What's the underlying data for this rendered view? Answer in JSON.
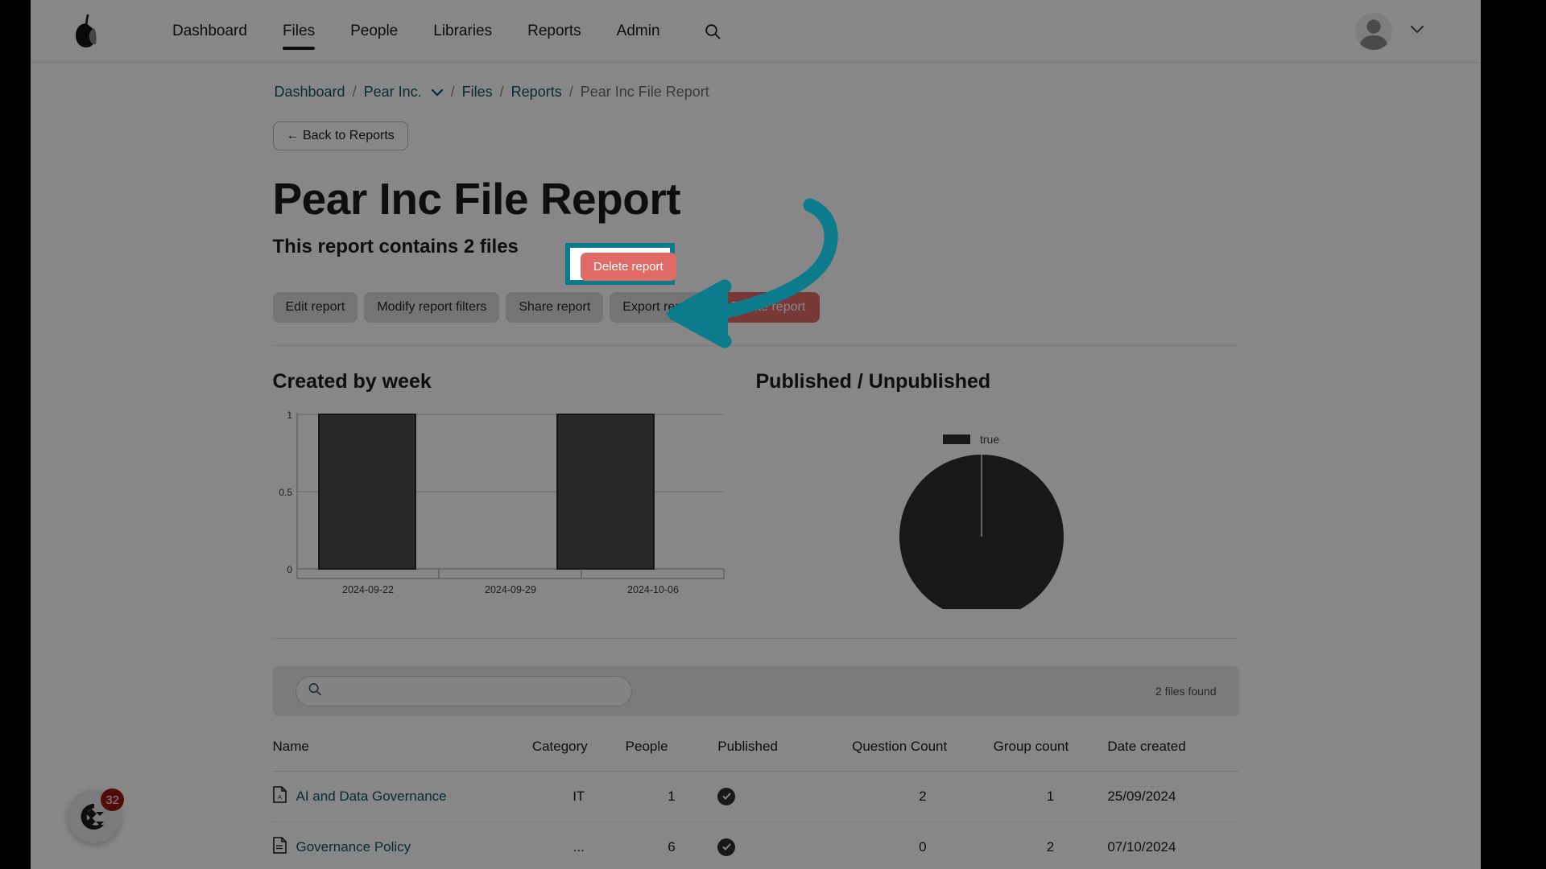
{
  "navbar": {
    "logo_name": "pear-logo",
    "links": [
      {
        "label": "Dashboard",
        "active": false
      },
      {
        "label": "Files",
        "active": true
      },
      {
        "label": "People",
        "active": false
      },
      {
        "label": "Libraries",
        "active": false
      },
      {
        "label": "Reports",
        "active": false
      },
      {
        "label": "Admin",
        "active": false
      }
    ],
    "search_icon": "search-icon",
    "avatar_icon": "user-avatar-icon",
    "chevron": "⌄"
  },
  "breadcrumb": {
    "items": [
      {
        "label": "Dashboard",
        "type": "link"
      },
      {
        "label": "/",
        "type": "sep"
      },
      {
        "label": "Pear Inc.",
        "type": "link-dropdown"
      },
      {
        "label": "/",
        "type": "sep"
      },
      {
        "label": "Files",
        "type": "link"
      },
      {
        "label": "/",
        "type": "sep"
      },
      {
        "label": "Reports",
        "type": "link"
      },
      {
        "label": "/",
        "type": "sep"
      },
      {
        "label": "Pear Inc File Report",
        "type": "current"
      }
    ]
  },
  "back_button": {
    "label": "← Back to Reports"
  },
  "header": {
    "title": "Pear Inc File Report",
    "subtitle": "This report contains 2 files"
  },
  "actions": {
    "edit": "Edit report",
    "modify": "Modify report filters",
    "share": "Share report",
    "export": "Export report",
    "delete": "Delete report"
  },
  "annotation": {
    "highlight_color": "#0c7b8c",
    "highlight_target": "Delete report",
    "arrow_color": "#0c7b8c"
  },
  "charts": {
    "bar": {
      "title": "Created by week"
    },
    "pie": {
      "title": "Published / Unpublished"
    }
  },
  "chart_data": [
    {
      "type": "bar",
      "title": "Created by week",
      "categories": [
        "2024-09-22",
        "2024-09-29",
        "2024-10-06"
      ],
      "values": [
        1,
        0,
        1
      ],
      "xlabel": "",
      "ylabel": "",
      "ylim": [
        0,
        1
      ],
      "yticks": [
        "0",
        "0.5",
        "1"
      ],
      "grid": true,
      "legend": "none",
      "bar_color": "#4a4a4a"
    },
    {
      "type": "pie",
      "title": "Published / Unpublished",
      "categories": [
        "true"
      ],
      "values": [
        2
      ],
      "percentages": [
        100
      ],
      "legend": [
        "true"
      ],
      "legend_position": "top-right",
      "slice_color": "#2e2e2e"
    }
  ],
  "table": {
    "search_placeholder": "",
    "search_value": "",
    "search_icon": "search-icon",
    "files_found": "2 files found",
    "columns": [
      "Name",
      "Category",
      "People",
      "Published",
      "Question Count",
      "Group count",
      "Date created"
    ],
    "rows": [
      {
        "icon": "pdf-file-icon",
        "name": "AI and Data Governance",
        "category": "IT",
        "people": "1",
        "published": true,
        "question_count": "2",
        "group_count": "1",
        "date_created": "25/09/2024"
      },
      {
        "icon": "doc-file-icon",
        "name": "Governance Policy",
        "category": "...",
        "people": "6",
        "published": true,
        "question_count": "0",
        "group_count": "2",
        "date_created": "07/10/2024"
      }
    ]
  },
  "widget": {
    "icon": "chat-widget-icon",
    "badge_count": "32",
    "badge_color": "#9b1414"
  }
}
